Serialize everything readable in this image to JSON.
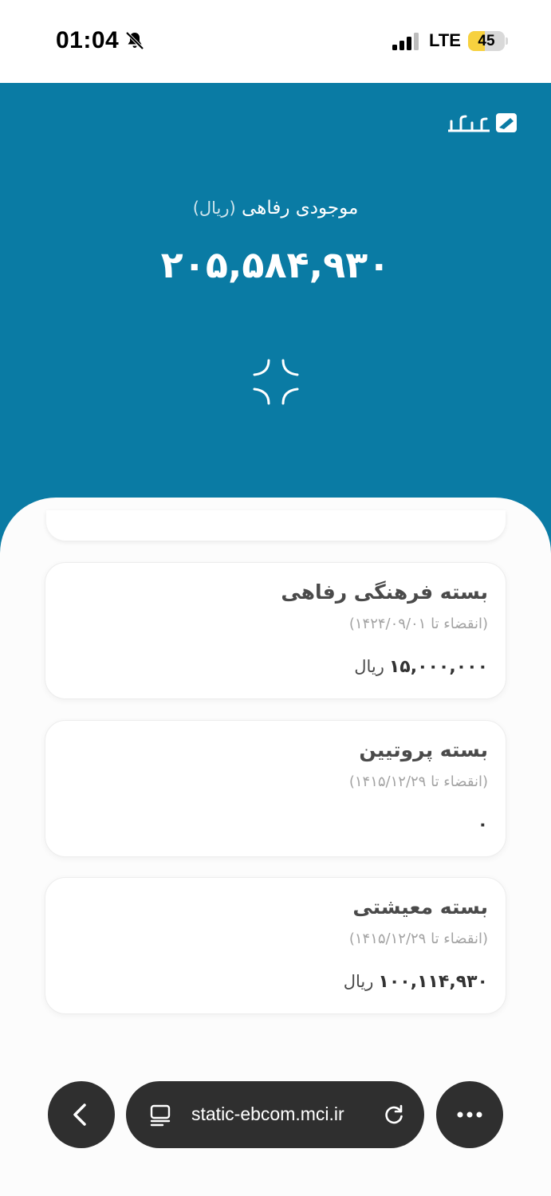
{
  "status_bar": {
    "time": "01:04",
    "network": "LTE",
    "battery_level": "45",
    "battery_percent": 45,
    "icons": [
      "bell-muted-icon",
      "signal-icon",
      "battery-icon"
    ]
  },
  "header": {
    "logo_icon": "brand-logo-icon",
    "balance_title": "موجودی رفاهی",
    "balance_unit": "(ریال)",
    "balance_amount": "۲۰۵,۵۸۴,۹۳۰",
    "collapse_icon": "collapse-icon",
    "background_color": "#0a7ba4"
  },
  "cards": [
    {
      "title": "بسته فرهنگی رفاهی",
      "expiry": "(انقضاء تا ۱۴۲۴/۰۹/۰۱)",
      "amount": "۱۵,۰۰۰,۰۰۰",
      "currency": "ریال"
    },
    {
      "title": "بسته پروتیین",
      "expiry": "(انقضاء تا ۱۴۱۵/۱۲/۲۹)",
      "amount": "۰",
      "currency": ""
    },
    {
      "title": "بسته معیشتی",
      "expiry": "(انقضاء تا ۱۴۱۵/۱۲/۲۹)",
      "amount": "۱۰۰,۱۱۴,۹۳۰",
      "currency": "ریال"
    }
  ],
  "browser": {
    "url": "static-ebcom.mci.ir",
    "icons": [
      "back-icon",
      "page-icon",
      "reload-icon",
      "more-icon"
    ]
  }
}
